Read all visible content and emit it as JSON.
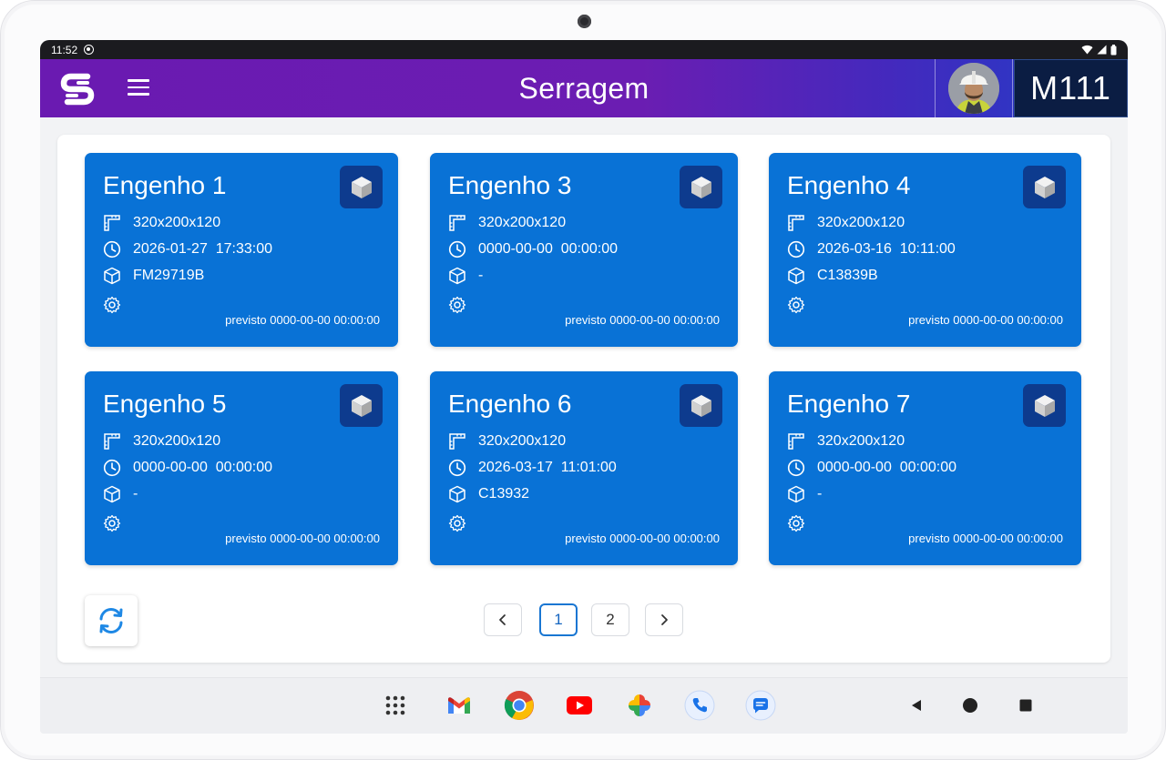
{
  "status_bar": {
    "time": "11:52"
  },
  "app_bar": {
    "title": "Serragem",
    "machine_code": "M111"
  },
  "cards": [
    {
      "title": "Engenho 1",
      "dimensions": "320x200x120",
      "datetime": "2026-01-27  17:33:00",
      "code": "FM29719B",
      "forecast": "previsto 0000-00-00 00:00:00"
    },
    {
      "title": "Engenho 3",
      "dimensions": "320x200x120",
      "datetime": "0000-00-00  00:00:00",
      "code": "-",
      "forecast": "previsto 0000-00-00 00:00:00"
    },
    {
      "title": "Engenho 4",
      "dimensions": "320x200x120",
      "datetime": "2026-03-16  10:11:00",
      "code": "C13839B",
      "forecast": "previsto 0000-00-00 00:00:00"
    },
    {
      "title": "Engenho 5",
      "dimensions": "320x200x120",
      "datetime": "0000-00-00  00:00:00",
      "code": "-",
      "forecast": "previsto 0000-00-00 00:00:00"
    },
    {
      "title": "Engenho 6",
      "dimensions": "320x200x120",
      "datetime": "2026-03-17  11:01:00",
      "code": "C13932",
      "forecast": "previsto 0000-00-00 00:00:00"
    },
    {
      "title": "Engenho 7",
      "dimensions": "320x200x120",
      "datetime": "0000-00-00  00:00:00",
      "code": "-",
      "forecast": "previsto 0000-00-00 00:00:00"
    }
  ],
  "pagination": {
    "prev": "‹",
    "pages": [
      "1",
      "2"
    ],
    "current": "1",
    "next": "›"
  },
  "icons": {
    "ruler": "ruler-icon",
    "clock": "clock-icon",
    "box": "cube-icon",
    "settings": "gear-icon",
    "refresh": "refresh-icon"
  },
  "colors": {
    "card": "#0972d6",
    "card_badge": "#0d3b8e",
    "app_bar_start": "#6a1ab1",
    "app_bar_end": "#1f3ec9",
    "machine_box": "#0b1d43",
    "accent": "#1976d2"
  }
}
